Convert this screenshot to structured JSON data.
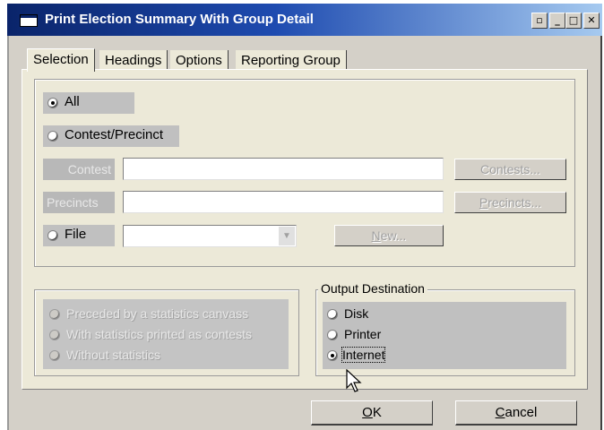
{
  "window": {
    "title": "Print Election Summary With Group Detail"
  },
  "tabs": [
    "Selection",
    "Headings",
    "Options",
    "Reporting Group"
  ],
  "selection": {
    "all_label": "All",
    "contest_precinct_label": "Contest/Precinct",
    "contest_label": "Contest",
    "precincts_label": "Precincts",
    "file_label": "File",
    "contests_button": "Contests...",
    "precincts_button_prefix": "P",
    "precincts_button_rest": "recincts...",
    "new_button_prefix": "N",
    "new_button_rest": "ew...",
    "selected": "All"
  },
  "statistics": {
    "options": [
      "Preceded by a statistics canvass",
      "With statistics printed as contests",
      "Without statistics"
    ]
  },
  "output": {
    "title": "Output Destination",
    "options": [
      "Disk",
      "Printer",
      "Internet"
    ],
    "selected": "Internet"
  },
  "footer": {
    "ok_prefix": "O",
    "ok_rest": "K",
    "cancel_prefix": "C",
    "cancel_rest": "ancel"
  },
  "icons": {
    "system": "window-icon",
    "restore": "restore-icon",
    "minimize": "minimize-icon",
    "maximize": "maximize-icon",
    "close": "close-icon",
    "cursor": "mouse-pointer-icon"
  }
}
